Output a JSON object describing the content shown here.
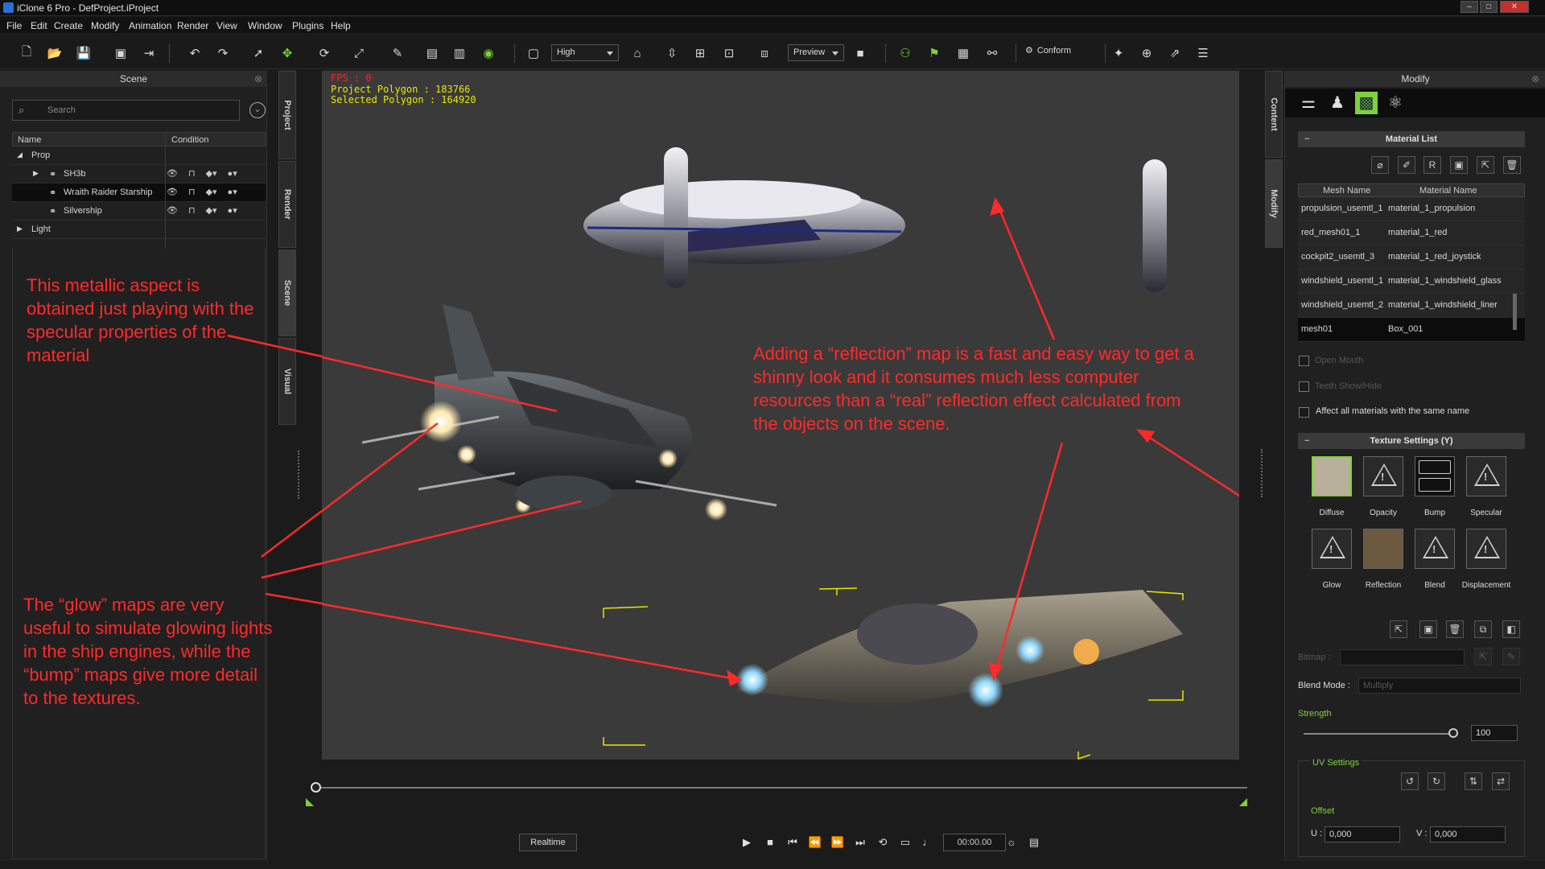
{
  "app": {
    "title": "iClone 6 Pro - DefProject.iProject"
  },
  "menu": [
    "File",
    "Edit",
    "Create",
    "Modify",
    "Animation",
    "Render",
    "View",
    "Window",
    "Plugins",
    "Help"
  ],
  "toolbar": {
    "quality": "High",
    "preview": "Preview",
    "conform": "Conform"
  },
  "scene": {
    "title": "Scene",
    "search_placeholder": "Search",
    "col_name": "Name",
    "col_condition": "Condition",
    "rows": [
      {
        "label": "Prop"
      },
      {
        "label": "SH3b"
      },
      {
        "label": "Wraith Raider Starship"
      },
      {
        "label": "Silvership"
      },
      {
        "label": "Light"
      }
    ]
  },
  "side_tabs": {
    "project": "Project",
    "render": "Render",
    "scene": "Scene",
    "visual": "Visual",
    "content": "Content",
    "modify": "Modify"
  },
  "viewport": {
    "fps": "FPS : 0",
    "project_polygon": "Project Polygon : 183766",
    "selected_polygon": "Selected Polygon : 164920"
  },
  "annotations": {
    "metallic": "This metallic aspect is obtained just playing with the specular properties of the material",
    "reflection": "Adding a “reflection” map is a fast and easy way to get a shinny look and it consumes much less computer resources than a “real” reflection effect calculated from the objects on the scene.",
    "glow": "The “glow” maps are very useful to simulate glowing lights in the ship engines, while the “bump” maps give more detail to the textures."
  },
  "timeline": {
    "realtime": "Realtime",
    "timecode": "00:00.00"
  },
  "modify": {
    "title": "Modify",
    "material_list": "Material List",
    "col_mesh": "Mesh Name",
    "col_material": "Material Name",
    "materials": [
      {
        "mesh": "propulsion_usemtl_1",
        "material": "material_1_propulsion"
      },
      {
        "mesh": "red_mesh01_1",
        "material": "material_1_red"
      },
      {
        "mesh": "cockpit2_usemtl_3",
        "material": "material_1_red_joystick"
      },
      {
        "mesh": "windshield_usemtl_1",
        "material": "material_1_windshield_glass"
      },
      {
        "mesh": "windshield_usemtl_2",
        "material": "material_1_windshield_liner"
      },
      {
        "mesh": "mesh01",
        "material": "Box_001"
      }
    ],
    "open_mouth": "Open Mouth",
    "teeth": "Teeth Show/Hide",
    "affect_all": "Affect all materials with the same name",
    "texture_settings": "Texture Settings  (Y)",
    "textures": [
      "Diffuse",
      "Opacity",
      "Bump",
      "Specular",
      "Glow",
      "Reflection",
      "Blend",
      "Displacement"
    ],
    "bitmap": "Bitmap :",
    "blend_mode": "Blend Mode :",
    "blend_value": "Multiply",
    "strength": "Strength",
    "strength_value": "100",
    "uv_settings": "UV Settings",
    "offset": "Offset",
    "u_label": "U :",
    "u_value": "0,000",
    "v_label": "V :",
    "v_value": "0,000"
  },
  "colors": {
    "accent": "#7fd13b",
    "annotation": "#ff2a2a",
    "stats_yellow": "#e8e800"
  }
}
